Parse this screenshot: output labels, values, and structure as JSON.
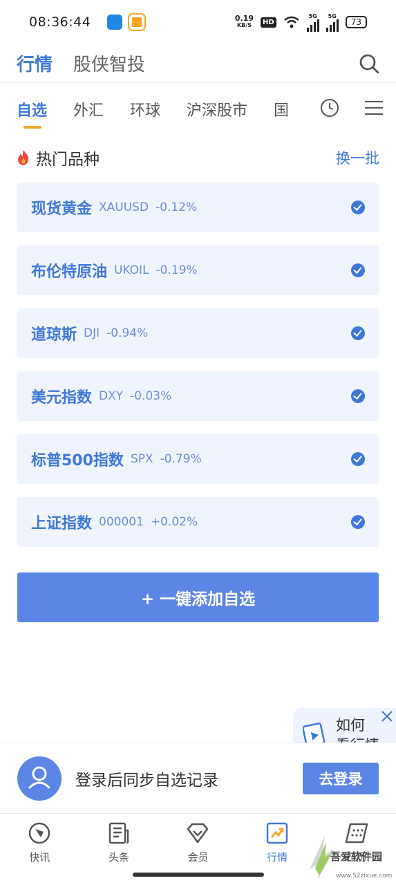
{
  "status_bar": {
    "time": "08:36:44",
    "net_speed_value": "0.19",
    "net_speed_unit": "KB/S",
    "hd": "HD",
    "sig1": "5G",
    "sig2": "5G",
    "battery": "73"
  },
  "top_nav": {
    "tabs": [
      {
        "label": "行情"
      },
      {
        "label": "股侠智投"
      }
    ]
  },
  "category_nav": {
    "tabs": [
      {
        "label": "自选"
      },
      {
        "label": "外汇"
      },
      {
        "label": "环球"
      },
      {
        "label": "沪深股市"
      },
      {
        "label": "国"
      }
    ]
  },
  "section": {
    "title": "热门品种",
    "refresh_label": "换一批"
  },
  "items": [
    {
      "name": "现货黄金",
      "code": "XAUUSD",
      "change": "-0.12%"
    },
    {
      "name": "布伦特原油",
      "code": "UKOIL",
      "change": "-0.19%"
    },
    {
      "name": "道琼斯",
      "code": "DJI",
      "change": "-0.94%"
    },
    {
      "name": "美元指数",
      "code": "DXY",
      "change": "-0.03%"
    },
    {
      "name": "标普500指数",
      "code": "SPX",
      "change": "-0.79%"
    },
    {
      "name": "上证指数",
      "code": "000001",
      "change": "+0.02%"
    }
  ],
  "add_button_label": "+ 一键添加自选",
  "float_card": {
    "line1": "如何",
    "line2": "看行情"
  },
  "login_bar": {
    "message": "登录后同步自选记录",
    "button_label": "去登录"
  },
  "tab_bar": {
    "tabs": [
      {
        "label": "快讯"
      },
      {
        "label": "头条"
      },
      {
        "label": "会员"
      },
      {
        "label": "行情"
      },
      {
        "label": "日历"
      }
    ]
  },
  "watermark": {
    "text": "吾爱软件园",
    "url": "www.52zixue.com"
  },
  "colors": {
    "accent": "#3f78d8",
    "button": "#5b86e5",
    "item_bg": "#f0f4fd",
    "tab_indicator": "#f5a623"
  }
}
